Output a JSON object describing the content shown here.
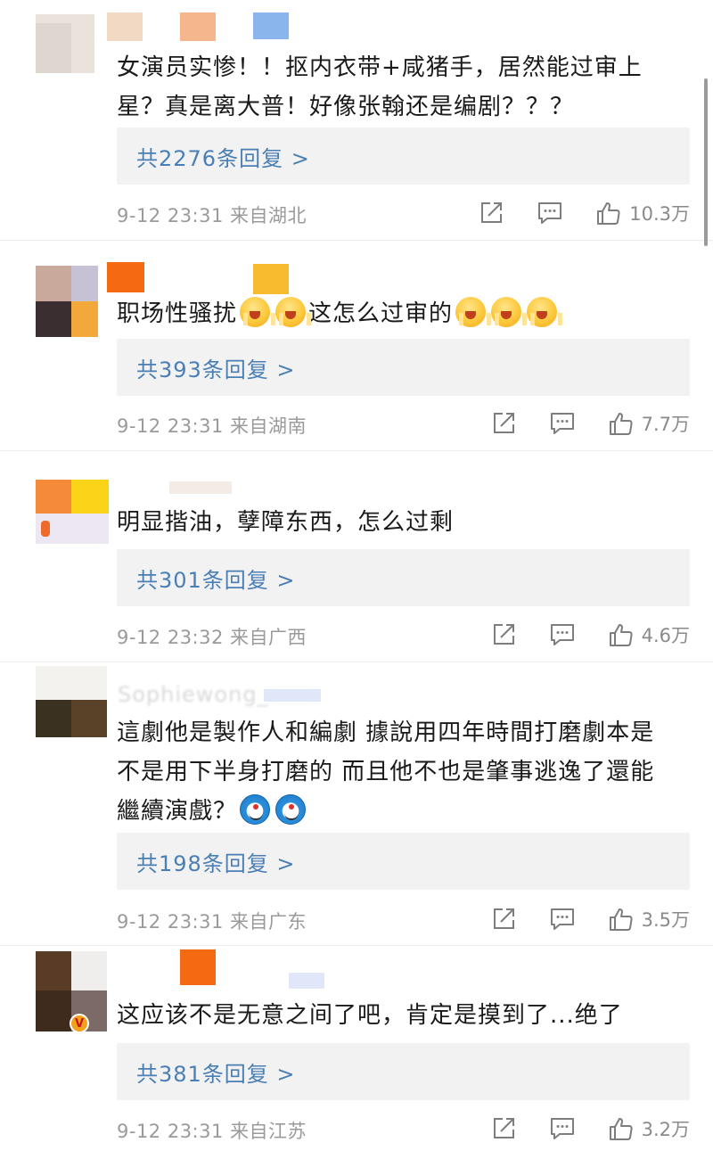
{
  "comments": [
    {
      "text": "女演员实惨！！抠内衣带+咸猪手，居然能过审上星？真是离大普！好像张翰还是编剧？？？",
      "emojis": [],
      "replies_label": "共2276条回复 >",
      "time": "9-12 23:31",
      "location": "来自湖北",
      "likes": "10.3万"
    },
    {
      "text_parts": [
        "职场性骚扰",
        "这怎么过审的"
      ],
      "emoji_icon": "shocked-face-emoji",
      "replies_label": "共393条回复 >",
      "time": "9-12 23:31",
      "location": "来自湖南",
      "likes": "7.7万"
    },
    {
      "text": "明显揩油，孽障东西，怎么过剩",
      "replies_label": "共301条回复 >",
      "time": "9-12 23:32",
      "location": "来自广西",
      "likes": "4.6万"
    },
    {
      "text": "這劇他是製作人和編劇 據說用四年時間打磨劇本是不是用下半身打磨的 而且他不也是肇事逃逸了還能繼續演戲？",
      "emoji_icon": "doraemon-emoji",
      "username_partial": "Sophiewong_",
      "replies_label": "共198条回复 >",
      "time": "9-12 23:31",
      "location": "来自广东",
      "likes": "3.5万"
    },
    {
      "text": "这应该不是无意之间了吧，肯定是摸到了...绝了",
      "badge": "V",
      "replies_label": "共381条回复 >",
      "time": "9-12 23:31",
      "location": "来自江苏",
      "likes": "3.2万"
    }
  ],
  "icons": {
    "share": "share-icon",
    "reply": "comment-icon",
    "like": "thumbs-up-icon"
  },
  "colors": {
    "reply_link": "#4a7fb5",
    "meta_text": "#9a9a9a",
    "reply_box_bg": "#f2f2f2"
  }
}
